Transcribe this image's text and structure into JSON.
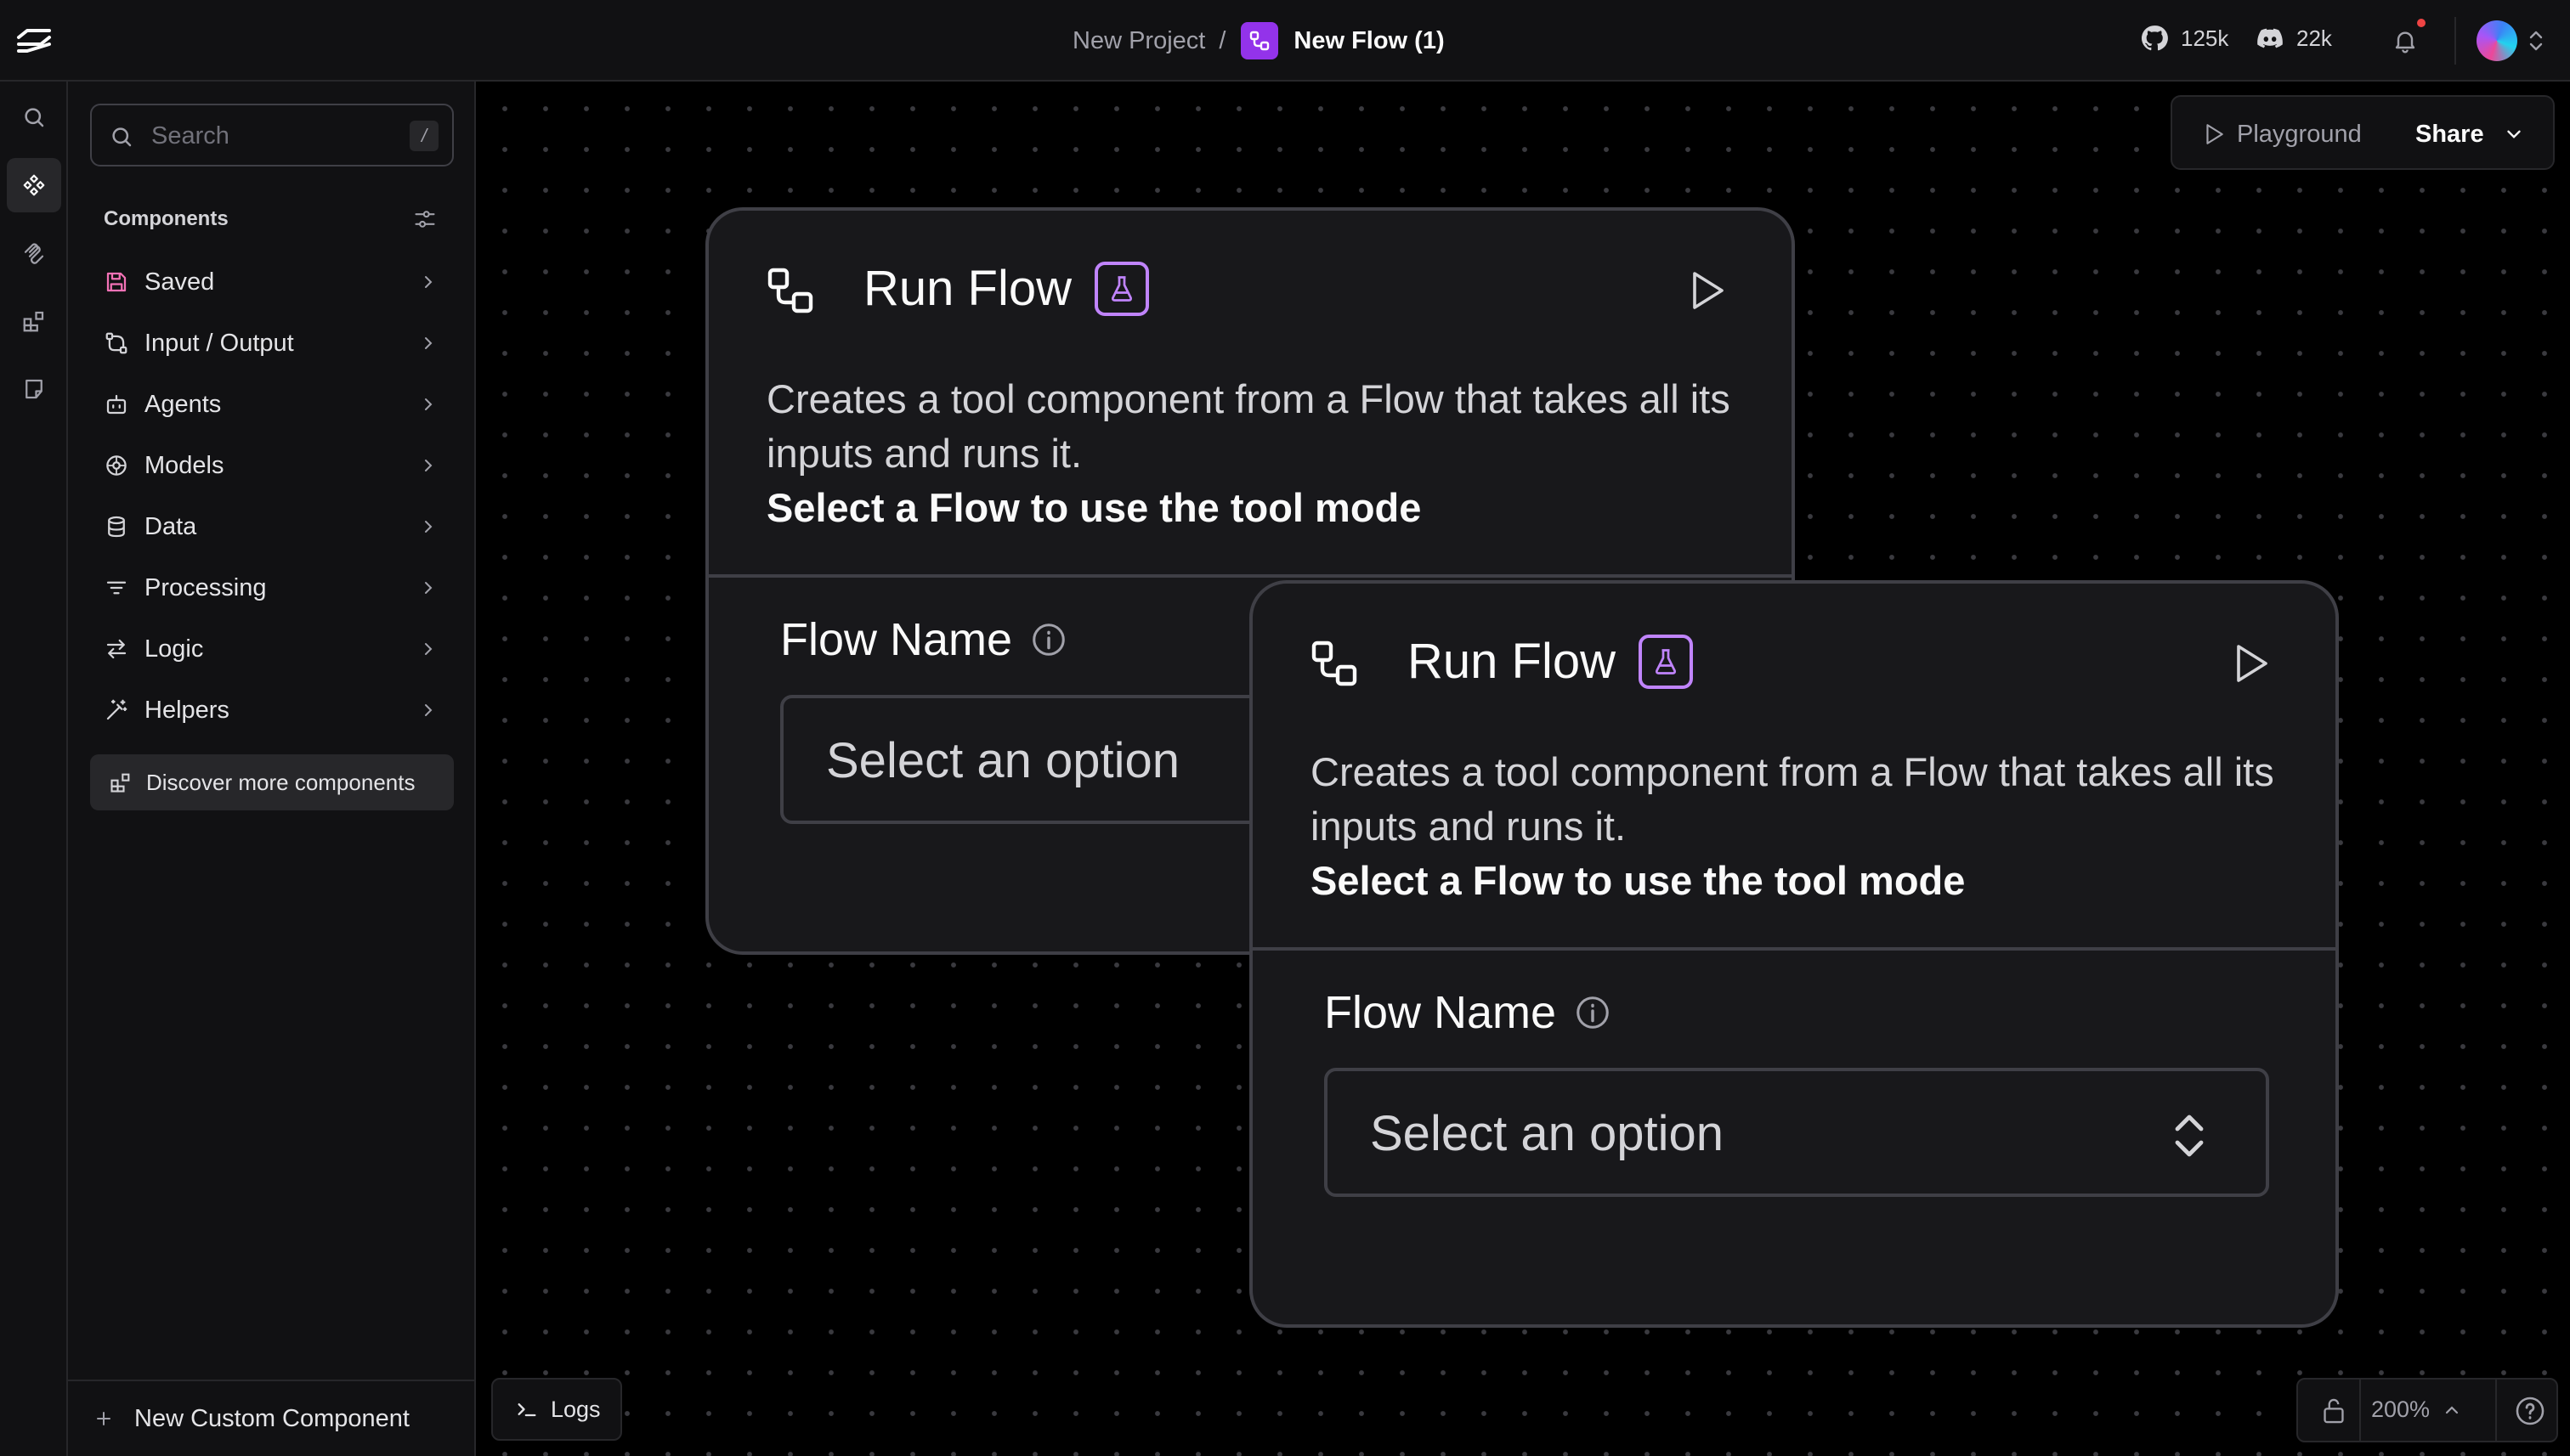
{
  "header": {
    "breadcrumb_project": "New Project",
    "breadcrumb_separator": "/",
    "breadcrumb_flow": "New Flow (1)",
    "github_stars": "125k",
    "discord_members": "22k"
  },
  "sidebar": {
    "search_placeholder": "Search",
    "search_shortcut": "/",
    "components_header": "Components",
    "categories": [
      {
        "label": "Saved",
        "icon": "save-icon"
      },
      {
        "label": "Input / Output",
        "icon": "input-output-icon"
      },
      {
        "label": "Agents",
        "icon": "bot-icon"
      },
      {
        "label": "Models",
        "icon": "brain-icon"
      },
      {
        "label": "Data",
        "icon": "database-icon"
      },
      {
        "label": "Processing",
        "icon": "list-filter-icon"
      },
      {
        "label": "Logic",
        "icon": "arrows-swap-icon"
      },
      {
        "label": "Helpers",
        "icon": "wand-icon"
      }
    ],
    "discover_label": "Discover more components",
    "new_custom_label": "New Custom Component"
  },
  "canvas_toolbar": {
    "playground_label": "Playground",
    "share_label": "Share"
  },
  "nodes": [
    {
      "title": "Run Flow",
      "description": "Creates a tool component from a Flow that takes all its inputs and runs it.",
      "description_bold": "Select a Flow to use the tool mode",
      "field_label": "Flow Name",
      "select_placeholder": "Select an option"
    },
    {
      "title": "Run Flow",
      "description": "Creates a tool component from a Flow that takes all its inputs and runs it.",
      "description_bold": "Select a Flow to use the tool mode",
      "field_label": "Flow Name",
      "select_placeholder": "Select an option"
    }
  ],
  "footer": {
    "logs_label": "Logs",
    "zoom_level": "200%"
  },
  "colors": {
    "accent": "#9333ea",
    "beta_badge": "#c084fc",
    "saved_icon": "#f472b6"
  }
}
